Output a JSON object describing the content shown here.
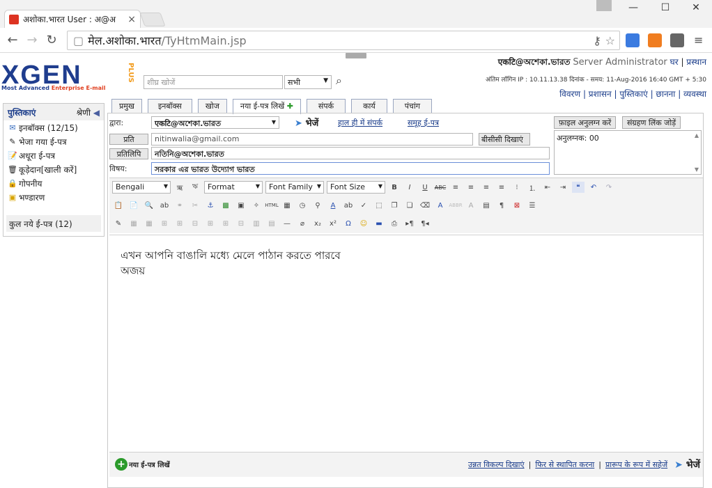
{
  "browser": {
    "tab_title": "अशोका.भारत User : अ@अ",
    "tab_close": "×",
    "url_host": "मेल.अशोका.भारत",
    "url_path": "/TyHtmMain.jsp",
    "min": "—",
    "max": "☐",
    "close": "✕"
  },
  "logo": {
    "main": "XGEN",
    "plus": "PLUS",
    "sub_a": "Most Advanced ",
    "sub_b": "Enterprise E-mail"
  },
  "search": {
    "placeholder": "शीघ्र खोजें",
    "scope": "सभी"
  },
  "header": {
    "account": "एकटि@অশেকা.ভারত",
    "role": "Server Administrator",
    "home": "घर",
    "logout": "प्रस्थान",
    "last_login": "अंतिम लॉगिन IP : 10.11.13.38 दिनांक - समय: 11-Aug-2016 16:40 GMT + 5:30",
    "links": [
      "विवरण",
      "प्रशासन",
      "पुस्तिकाएं",
      "छानना",
      "व्यवस्था"
    ]
  },
  "sidebar": {
    "title": "पुस्तिकाएं",
    "category": "श्रेणी",
    "items": [
      {
        "label": "इनबॉक्स (12/15)"
      },
      {
        "label": "भेजा गया ई-पत्र"
      },
      {
        "label": "अधूरा ई-पत्र"
      },
      {
        "label": "कूड़ेदान[खाली करें]"
      },
      {
        "label": "गोपनीय"
      },
      {
        "label": "भण्डारण"
      }
    ],
    "footer": "कुल नये ई-पत्र (12)"
  },
  "tabs": [
    "प्रमुख",
    "इनबॉक्स",
    "खोज",
    "नया ई-पत्र लिखें",
    "संपर्क",
    "कार्य",
    "पंचांग"
  ],
  "compose": {
    "from_label": "द्वारा:",
    "from_value": "एकटि@অশেকা.ভারত",
    "send_label": "भेजें",
    "recent": "हाल ही में संपर्क",
    "group": "समूह ई-पत्र",
    "attach": "फ़ाइल अनुलग्न करें",
    "storage": "संग्रहण लिंक जोड़ें",
    "to_label": "प्रति",
    "to_value": "nitinwalia@gmail.com",
    "bcc": "बीसीसी दिखाएं",
    "cc_label": "प्रतिलिपि",
    "cc_value": "নতিনি@অশেকা.ভারত",
    "subject_label": "विषय:",
    "subject_value": "সরকার এর ভারত উদ্যোগ ভারত",
    "attachments_label": "अनुलग्नक: 00"
  },
  "rte": {
    "lang": "Bengali",
    "format": "Format",
    "font_family": "Font Family",
    "font_size": "Font Size"
  },
  "body": {
    "line1": "এখন আপনি বাঙালি মধ্যে মেলে পাঠান করতে পারবে",
    "line2": "অজয়"
  },
  "footer": {
    "new": "नया ई-पत्र लिखें",
    "adv": "उन्नत विकल्प दिखाएं",
    "restore": "फिर से स्थापित करना",
    "draft": "प्रारूप के रूप में सहेजें",
    "send": "भेजें"
  }
}
